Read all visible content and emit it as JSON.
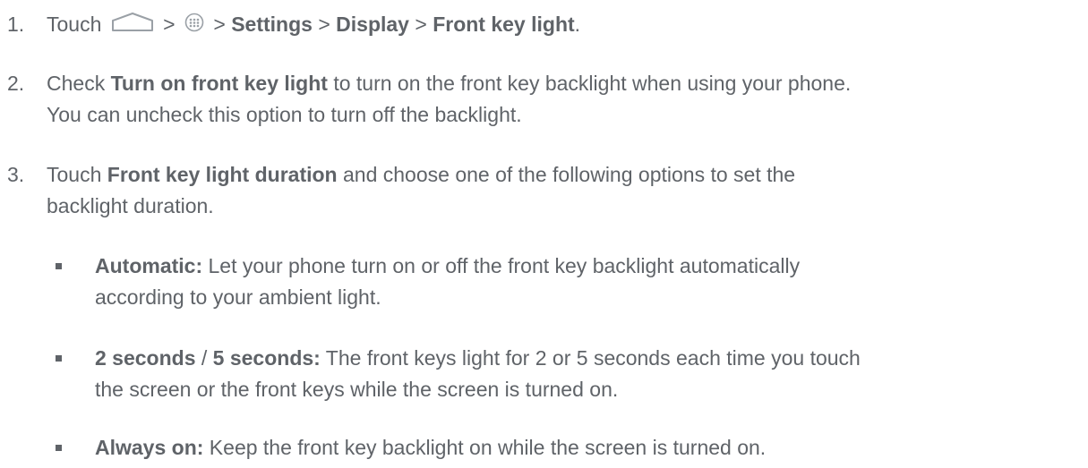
{
  "steps": [
    {
      "number": "1.",
      "touch": "Touch",
      "sep": ">",
      "home_icon": "home-icon",
      "apps_icon": "apps-grid-icon",
      "settings": "Settings",
      "display": "Display",
      "front_key_light": "Front key light",
      "period": "."
    },
    {
      "number": "2.",
      "prefix": "Check ",
      "bold": "Turn on front key light",
      "suffix": " to turn on the front key backlight when using your phone.",
      "line2": "You can uncheck this option to turn off the backlight."
    },
    {
      "number": "3.",
      "prefix": "Touch ",
      "bold": "Front key light duration",
      "suffix": " and choose one of the following options to set the",
      "line2": "backlight duration."
    }
  ],
  "bullets": [
    {
      "bold": "Automatic:",
      "line1": " Let your phone turn on or off the front key backlight automatically",
      "line2": "according to your ambient light."
    },
    {
      "bold_a": "2 seconds",
      "slash": " / ",
      "bold_b": "5 seconds:",
      "line1": " The front keys light for 2 or 5 seconds each time you touch",
      "line2": "the screen or the front keys while the screen is turned on."
    },
    {
      "bold": "Always on:",
      "line1": " Keep the front key backlight on while the screen is turned on."
    }
  ]
}
